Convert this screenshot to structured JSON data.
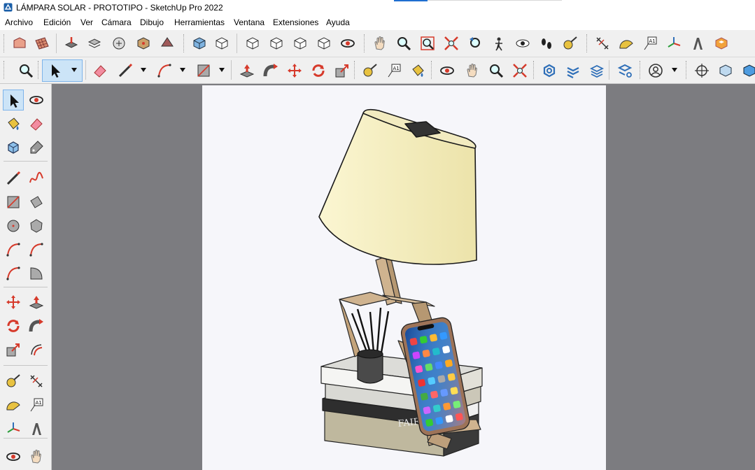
{
  "window": {
    "title": "LÁMPARA SOLAR - PROTOTIPO - SketchUp Pro 2022",
    "app_icon": "sketchup-icon"
  },
  "menu": [
    "Archivo",
    "Edición",
    "Ver",
    "Cámara",
    "Dibujo",
    "Herramientas",
    "Ventana",
    "Extensiones",
    "Ayuda"
  ],
  "toolbar_top": {
    "tools": [
      "warehouse",
      "sandbox-grid",
      "extension-warehouse",
      "layout-send",
      "model-info",
      "style-builder",
      "component-options",
      "iso-view",
      "top-view",
      "front-view",
      "right-view",
      "back-view",
      "left-view",
      "orbit",
      "pan",
      "zoom",
      "zoom-window",
      "zoom-extents",
      "previous-view",
      "position-camera",
      "look-around",
      "walk",
      "tape-measure",
      "dimension",
      "protractor",
      "text",
      "axes",
      "3d-text",
      "extension-manager"
    ]
  },
  "toolbar_main": {
    "tools": [
      "zoom-tool",
      "select",
      "eraser",
      "line",
      "arc",
      "rectangle",
      "push-pull",
      "follow-me",
      "move",
      "rotate",
      "scale",
      "tape-measure",
      "text",
      "paint-bucket",
      "orbit",
      "pan",
      "zoom",
      "zoom-extents",
      "solid-tools",
      "intersect",
      "outer-shell",
      "trim",
      "user-profile",
      "axis-view",
      "x-ray",
      "wireframe"
    ],
    "selected": "select"
  },
  "tools_left": {
    "items": [
      "select",
      "orbit",
      "paint-bucket",
      "eraser",
      "make-component",
      "tag",
      "line",
      "freehand",
      "rectangle",
      "rotated-rectangle",
      "circle",
      "polygon",
      "arc",
      "2-point-arc",
      "3-point-arc",
      "pie",
      "move",
      "push-pull",
      "rotate",
      "follow-me",
      "scale",
      "offset",
      "tape-measure",
      "dimension",
      "protractor",
      "text",
      "axes",
      "3d-text",
      "orbit",
      "pan"
    ],
    "selected": "select"
  },
  "colors": {
    "lampshade": "#f6f0c0",
    "wood": "#cfb38f",
    "phone_frame": "#9d7358",
    "canvas_bg": "#f6f6fa",
    "workspace": "#7c7c80",
    "toolbar_bg": "#f0f0f0",
    "selection": "#cce4f7"
  },
  "model": {
    "book_title": "FAIRS"
  }
}
